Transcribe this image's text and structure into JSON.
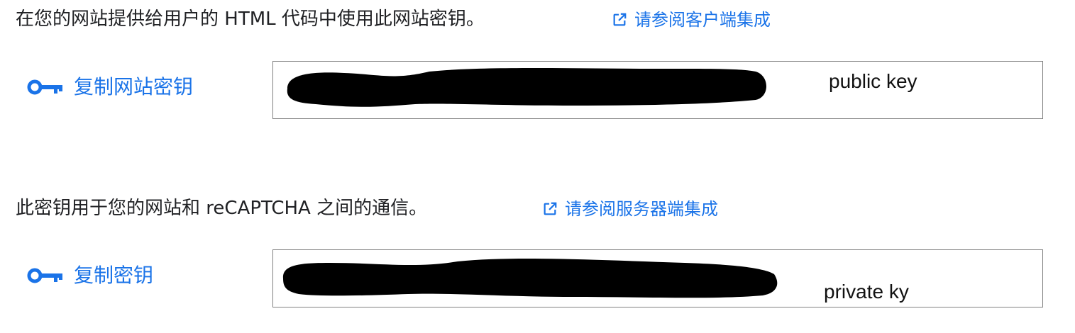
{
  "site_key_section": {
    "description": "在您的网站提供给用户的 HTML 代码中使用此网站密钥。",
    "link_label": "请参阅客户端集成",
    "link_icon": "open-in-new-icon",
    "copy_label": "复制网站密钥",
    "copy_icon": "key-icon",
    "annotation": "public key",
    "value_redacted": true
  },
  "secret_key_section": {
    "description": "此密钥用于您的网站和 reCAPTCHA 之间的通信。",
    "link_label": "请参阅服务器端集成",
    "link_icon": "open-in-new-icon",
    "copy_label": "复制密钥",
    "copy_icon": "key-icon",
    "annotation": "private ky",
    "value_redacted": true
  },
  "colors": {
    "link_blue": "#1a73e8",
    "text": "#202124",
    "box_border": "#808080",
    "redaction": "#000000"
  }
}
